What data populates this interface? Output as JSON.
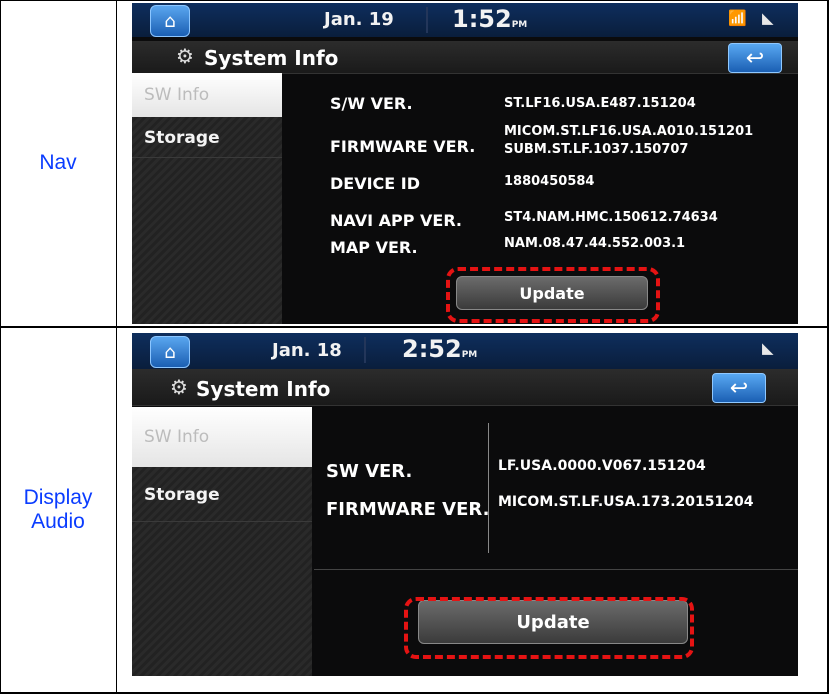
{
  "rows": [
    {
      "label": "Nav",
      "screen": {
        "date": "Jan. 19",
        "time": "1:52",
        "ampm": "PM",
        "title": "System Info",
        "menu": [
          "SW Info",
          "Storage"
        ],
        "info": [
          {
            "label": "S/W VER.",
            "value": "ST.LF16.USA.E487.151204"
          },
          {
            "label": "FIRMWARE VER.",
            "value": "MICOM.ST.LF16.USA.A010.151201",
            "value2": "SUBM.ST.LF.1037.150707"
          },
          {
            "label": "DEVICE ID",
            "value": "1880450584"
          },
          {
            "label": "NAVI APP VER.",
            "value": "ST4.NAM.HMC.150612.74634"
          },
          {
            "label": "MAP VER.",
            "value": "NAM.08.47.44.552.003.1"
          }
        ],
        "update_label": "Update"
      }
    },
    {
      "label_line1": "Display",
      "label_line2": "Audio",
      "screen": {
        "date": "Jan. 18",
        "time": "2:52",
        "ampm": "PM",
        "title": "System Info",
        "menu": [
          "SW Info",
          "Storage"
        ],
        "info": [
          {
            "label": "SW VER.",
            "value": "LF.USA.0000.V067.151204"
          },
          {
            "label": "FIRMWARE VER.",
            "value": "MICOM.ST.LF.USA.173.20151204"
          }
        ],
        "update_label": "Update"
      }
    }
  ],
  "colors": {
    "label_text": "#0a3cff",
    "highlight": "#e51313",
    "status_bar": "#0e2e5d"
  }
}
